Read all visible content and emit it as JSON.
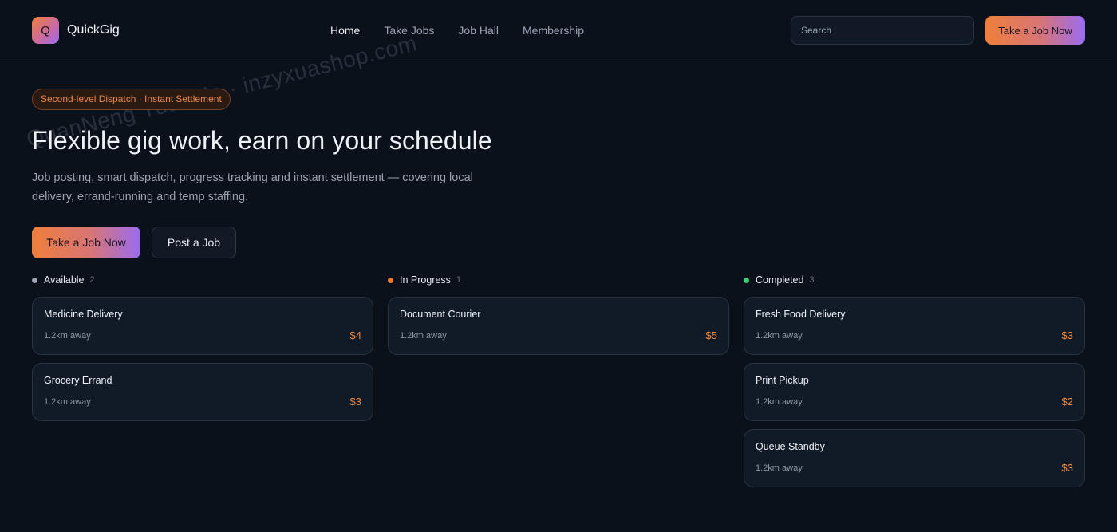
{
  "header": {
    "logo_letter": "Q",
    "brand": "QuickGig",
    "nav": [
      {
        "label": "Home",
        "active": true
      },
      {
        "label": "Take Jobs",
        "active": false
      },
      {
        "label": "Job Hall",
        "active": false
      },
      {
        "label": "Membership",
        "active": false
      }
    ],
    "search_placeholder": "Search",
    "cta_label": "Take a Job Now"
  },
  "hero": {
    "badge": "Second-level Dispatch · Instant Settlement",
    "title": "Flexible gig work, earn on your schedule",
    "description": "Job posting, smart dispatch, progress tracking and instant settlement — covering local delivery, errand-running and temp staffing.",
    "primary_label": "Take a Job Now",
    "secondary_label": "Post a Job"
  },
  "board": {
    "columns": [
      {
        "name": "Available",
        "count": "2",
        "dot_color": "#9aa3b0",
        "cards": [
          {
            "title": "Medicine Delivery",
            "distance": "1.2km away",
            "price": "$4"
          },
          {
            "title": "Grocery Errand",
            "distance": "1.2km away",
            "price": "$3"
          }
        ]
      },
      {
        "name": "In Progress",
        "count": "1",
        "dot_color": "#f07a2e",
        "cards": [
          {
            "title": "Document Courier",
            "distance": "1.2km away",
            "price": "$5"
          }
        ]
      },
      {
        "name": "Completed",
        "count": "3",
        "dot_color": "#3fcf7a",
        "cards": [
          {
            "title": "Fresh Food Delivery",
            "distance": "1.2km away",
            "price": "$3"
          },
          {
            "title": "Print Pickup",
            "distance": "1.2km away",
            "price": "$2"
          },
          {
            "title": "Queue Standby",
            "distance": "1.2km away",
            "price": "$3"
          }
        ]
      }
    ]
  },
  "watermark": "QuanNeng YuanMa · inzyxuashop.com",
  "colors": {
    "background": "#0b111b",
    "accent_orange": "#ef7f3a",
    "accent_purple": "#9b6af0",
    "price": "#f08a3e"
  }
}
